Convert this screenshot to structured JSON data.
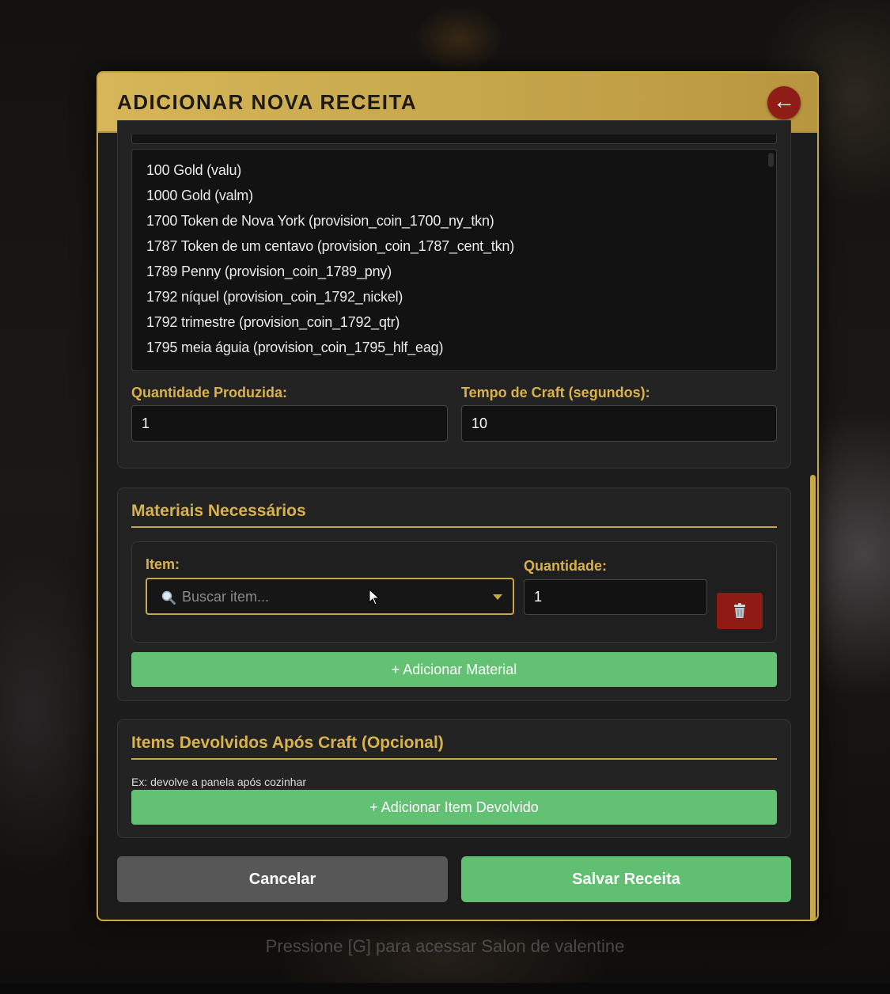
{
  "modal": {
    "title": "ADICIONAR NOVA RECEITA",
    "close_icon": "arrow-left-icon",
    "close_glyph": "←"
  },
  "item_list": {
    "options": [
      "100 Gold (valu)",
      "1000 Gold (valm)",
      "1700 Token de Nova York (provision_coin_1700_ny_tkn)",
      "1787 Token de um centavo (provision_coin_1787_cent_tkn)",
      "1789 Penny (provision_coin_1789_pny)",
      "1792 níquel (provision_coin_1792_nickel)",
      "1792 trimestre (provision_coin_1792_qtr)",
      "1795 meia águia (provision_coin_1795_hlf_eag)"
    ]
  },
  "production": {
    "quantity_label": "Quantidade Produzida:",
    "quantity_value": "1",
    "time_label": "Tempo de Craft (segundos):",
    "time_value": "10"
  },
  "materials": {
    "title": "Materiais Necessários",
    "item_label": "Item:",
    "search_placeholder": "Buscar item...",
    "search_icon": "magnifier-icon",
    "quantity_label": "Quantidade:",
    "quantity_value": "1",
    "delete_icon": "trash-icon",
    "add_button": "+ Adicionar Material"
  },
  "returned": {
    "title": "Items Devolvidos Após Craft (Opcional)",
    "hint": "Ex: devolve a panela após cozinhar",
    "add_button": "+ Adicionar Item Devolvido"
  },
  "footer": {
    "cancel": "Cancelar",
    "save": "Salvar Receita"
  },
  "overlay_hint": "Pressione [G] para acessar Salon de valentine",
  "colors": {
    "gold": "#c9a84a",
    "green": "#62c172",
    "danger": "#8e1c15",
    "panel": "#1c1c1c"
  }
}
